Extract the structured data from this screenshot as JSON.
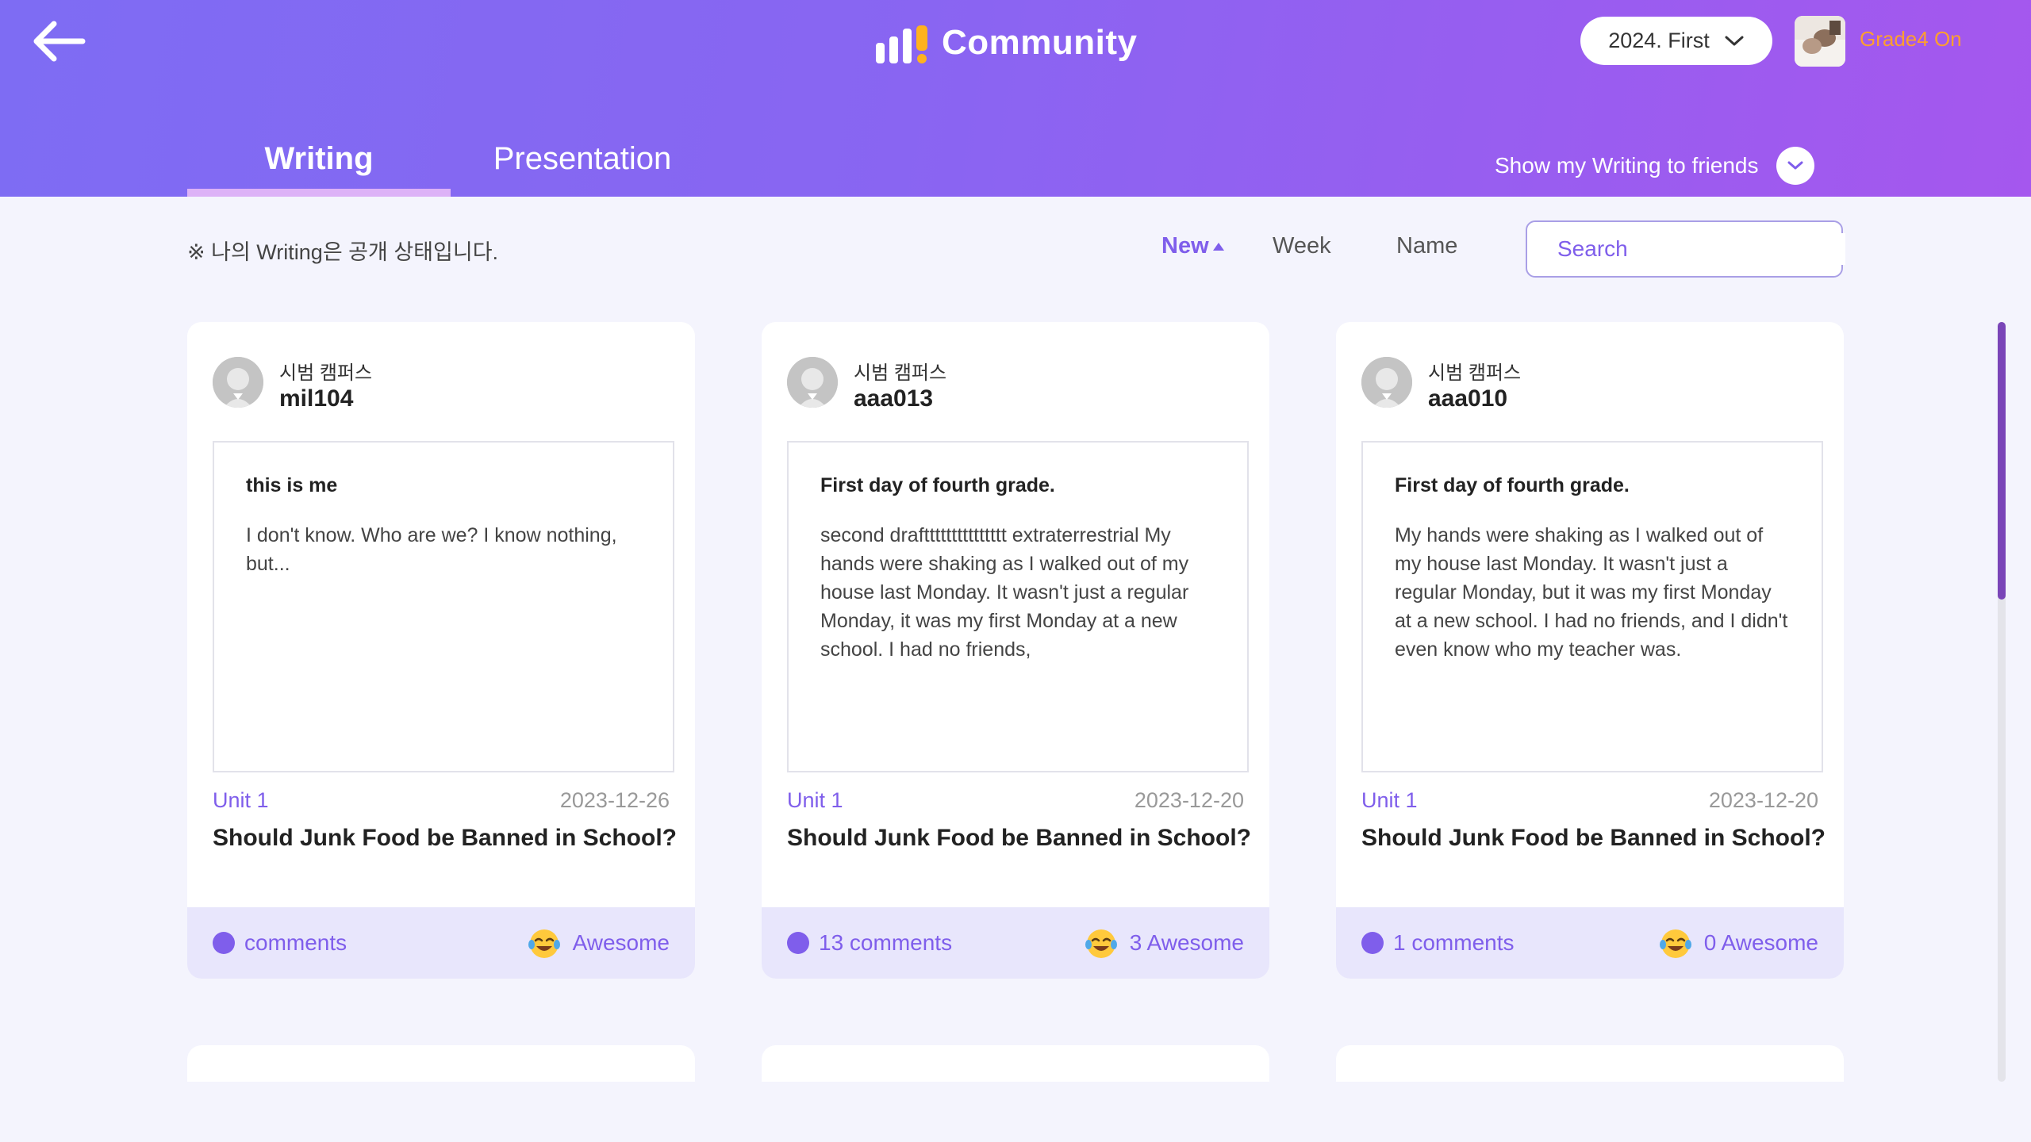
{
  "header": {
    "title": "Community",
    "semester": "2024. First",
    "user_name": "Grade4 On"
  },
  "tabs": [
    {
      "label": "Writing",
      "active": true
    },
    {
      "label": "Presentation",
      "active": false
    }
  ],
  "share_toggle_label": "Show my Writing to friends",
  "notice": "※ 나의 Writing은 공개 상태입니다.",
  "sort": {
    "options": [
      "New",
      "Week",
      "Name"
    ],
    "active": "New"
  },
  "search": {
    "placeholder": "Search"
  },
  "cards": [
    {
      "campus": "시범 캠퍼스",
      "username": "mil104",
      "title": "this is me",
      "text": "I don't know. Who are we? I know nothing, but...",
      "unit": "Unit 1",
      "date": "2023-12-26",
      "topic": "Should Junk Food be Banned in School?",
      "comments": "comments",
      "awesome": "Awesome"
    },
    {
      "campus": "시범 캠퍼스",
      "username": "aaa013",
      "title": "First day of fourth grade.",
      "text": "second drafttttttttttttttt extraterrestrial My hands were shaking as I walked out of my house last Monday. It wasn't just a regular Monday, it was my first Monday at a new school. I had no friends,",
      "unit": "Unit 1",
      "date": "2023-12-20",
      "topic": "Should Junk Food be Banned in School?",
      "comments": "13 comments",
      "awesome": "3 Awesome"
    },
    {
      "campus": "시범 캠퍼스",
      "username": "aaa010",
      "title": "First day of fourth grade.",
      "text": "My hands were shaking as I walked out of my house last Monday. It wasn't just a regular Monday, but it was my first Monday at a new school. I had no friends, and I didn't even know who my teacher was.",
      "unit": "Unit 1",
      "date": "2023-12-20",
      "topic": "Should Junk Food be Banned in School?",
      "comments": "1 comments",
      "awesome": "0 Awesome"
    }
  ],
  "colors": {
    "accent": "#7F5EEB",
    "header_start": "#7E6CF3",
    "header_end": "#A557EE",
    "user_name": "#FF9F2E",
    "logo_exclamation": "#FFB21E",
    "card_footer": "#E8E6FC",
    "page_background": "#F4F4FD"
  },
  "icons": [
    "back-arrow-icon",
    "logo-bars-icon",
    "chevron-down-icon",
    "search-icon",
    "comment-bubble-icon",
    "laughing-emoji-icon",
    "default-avatar-icon",
    "sort-up-triangle-icon"
  ]
}
